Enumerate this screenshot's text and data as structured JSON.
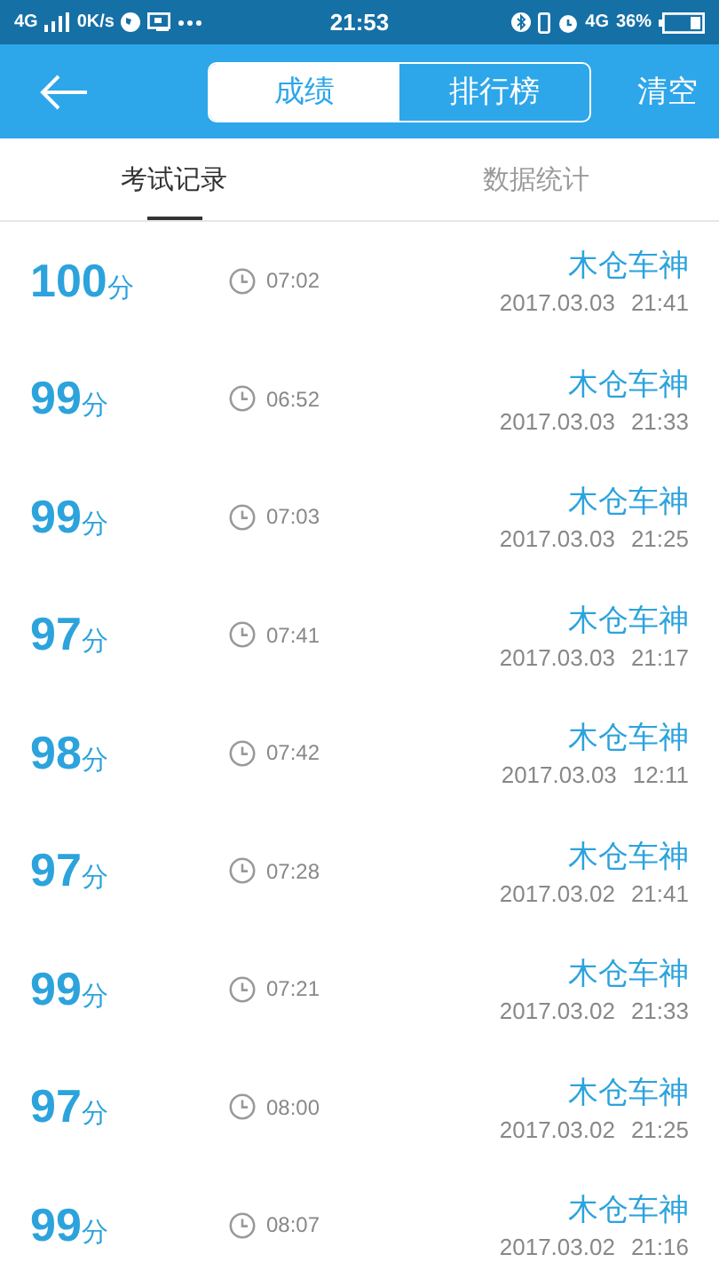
{
  "status_bar": {
    "network": "4G",
    "speed": "0K/s",
    "time": "21:53",
    "network_right": "4G",
    "battery": "36%"
  },
  "header": {
    "segments": [
      {
        "label": "成绩",
        "selected": true
      },
      {
        "label": "排行榜",
        "selected": false
      }
    ],
    "action": "清空"
  },
  "tabs": [
    {
      "label": "考试记录",
      "selected": true
    },
    {
      "label": "数据统计",
      "selected": false
    }
  ],
  "records": [
    {
      "score": "100",
      "unit": "分",
      "duration": "07:02",
      "name": "木仓车神",
      "date": "2017.03.03",
      "time": "21:41"
    },
    {
      "score": "99",
      "unit": "分",
      "duration": "06:52",
      "name": "木仓车神",
      "date": "2017.03.03",
      "time": "21:33"
    },
    {
      "score": "99",
      "unit": "分",
      "duration": "07:03",
      "name": "木仓车神",
      "date": "2017.03.03",
      "time": "21:25"
    },
    {
      "score": "97",
      "unit": "分",
      "duration": "07:41",
      "name": "木仓车神",
      "date": "2017.03.03",
      "time": "21:17"
    },
    {
      "score": "98",
      "unit": "分",
      "duration": "07:42",
      "name": "木仓车神",
      "date": "2017.03.03",
      "time": "12:11"
    },
    {
      "score": "97",
      "unit": "分",
      "duration": "07:28",
      "name": "木仓车神",
      "date": "2017.03.02",
      "time": "21:41"
    },
    {
      "score": "99",
      "unit": "分",
      "duration": "07:21",
      "name": "木仓车神",
      "date": "2017.03.02",
      "time": "21:33"
    },
    {
      "score": "97",
      "unit": "分",
      "duration": "08:00",
      "name": "木仓车神",
      "date": "2017.03.02",
      "time": "21:25"
    },
    {
      "score": "99",
      "unit": "分",
      "duration": "08:07",
      "name": "木仓车神",
      "date": "2017.03.02",
      "time": "21:16"
    }
  ]
}
